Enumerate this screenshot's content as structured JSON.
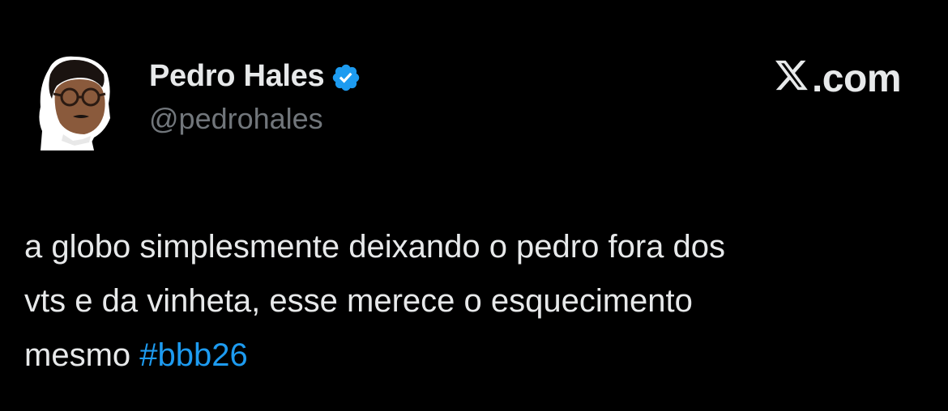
{
  "tweet": {
    "author": {
      "display_name": "Pedro Hales",
      "handle": "@pedrohales",
      "verified": true,
      "avatar_icon": "profile-photo"
    },
    "brand": {
      "logo_text": ".com",
      "logo_icon": "x-logo-icon"
    },
    "text": {
      "line1": "a globo simplesmente deixando o pedro fora dos",
      "line2": "vts e da vinheta, esse merece o esquecimento",
      "line3_prefix": "mesmo ",
      "hashtag": "#bbb26"
    },
    "colors": {
      "background": "#000000",
      "text": "#e7e9ea",
      "secondary": "#71767b",
      "accent": "#1d9bf0"
    }
  }
}
